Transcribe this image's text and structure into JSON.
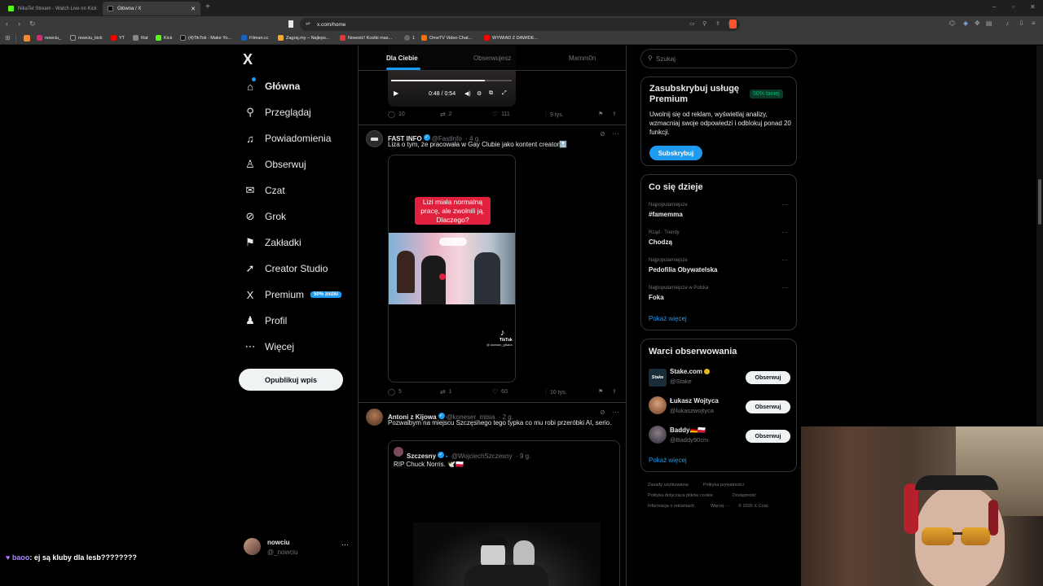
{
  "browser": {
    "tabs": [
      {
        "title": "NikaTel Stream - Watch Live on Kick",
        "active": false
      },
      {
        "title": "Główna / X",
        "active": true
      }
    ],
    "new_tab_symbol": "+",
    "url": "x.com/home",
    "bookmarks": [
      "nowciu_",
      "nowciu_kick",
      "YT",
      "Rat",
      "Kick",
      "(4)TikTok - Make Yo...",
      "Filman.cc",
      "Zagraj.my – Najleps...",
      "Nowość! Kostki mas...",
      "1",
      "OmeTV Video Chat...",
      "WYWIAD Z DAWIDE..."
    ]
  },
  "nav": {
    "logo": "X",
    "items": [
      {
        "label": "Główna",
        "icon": "home-icon",
        "glyph": "⌂"
      },
      {
        "label": "Przeglądaj",
        "icon": "search-icon",
        "glyph": "⚲"
      },
      {
        "label": "Powiadomienia",
        "icon": "bell-icon",
        "glyph": "♫"
      },
      {
        "label": "Obserwuj",
        "icon": "add-user-icon",
        "glyph": "♙"
      },
      {
        "label": "Czat",
        "icon": "mail-icon",
        "glyph": "✉"
      },
      {
        "label": "Grok",
        "icon": "grok-icon",
        "glyph": "⊘"
      },
      {
        "label": "Zakładki",
        "icon": "bookmark-icon",
        "glyph": "⚑"
      },
      {
        "label": "Creator Studio",
        "icon": "rocket-icon",
        "glyph": "➚"
      },
      {
        "label": "Premium",
        "icon": "x-premium-icon",
        "glyph": "X"
      },
      {
        "label": "Profil",
        "icon": "profile-icon",
        "glyph": "♟"
      },
      {
        "label": "Więcej",
        "icon": "more-circle-icon",
        "glyph": "⋯"
      }
    ],
    "premium_badge": "50% zniżki",
    "post_button": "Opublikuj wpis",
    "account": {
      "name": "nowciu",
      "handle": "@_nowciu",
      "menu": "···"
    }
  },
  "timeline": {
    "tabs": [
      "Dla Ciebie",
      "Obserwujesz",
      "Mamm0n"
    ],
    "video_player": {
      "time": "0:48 / 0:54",
      "progress": 0.78
    },
    "tweet0_actions": {
      "replies": "10",
      "reposts": "2",
      "likes": "111",
      "views": "9 tys."
    },
    "tweet1": {
      "name": "FAST INFO",
      "handle": "@FastInfo",
      "time": "· 4 g.",
      "text": "Liza o tym, że pracowała w Gay Clubie jako kontent creator🔝",
      "caption": "Lizi miała normalną pracę, ale zwolnili ją. Dlaczego?",
      "tiktok_label": "TikTok",
      "tiktok_user": "@ damian_gliwka",
      "actions": {
        "replies": "5",
        "reposts": "1",
        "likes": "60",
        "views": "10 tys."
      }
    },
    "tweet2": {
      "name": "Antoni z Kijowa",
      "handle": "@koneser_misia",
      "time": "· 2 g.",
      "text": "Pozwalbym na miejscu Szczęsnego tego typka co mu robi przeróbki AI, serio.",
      "quote": {
        "name": "Szczesny",
        "handle": "@WojciechSzczesny",
        "time": "· 9 g.",
        "text": "RIP Chuck Norris. 🕊️🇵🇱"
      }
    }
  },
  "sidebar": {
    "search_placeholder": "Szukaj",
    "premium": {
      "title": "Zasubskrybuj usługę Premium",
      "badge": "50% taniej",
      "text": "Uwolnij się od reklam, wyświetlaj analizy, wzmacniaj swoje odpowiedzi i odblokuj ponad 20 funkcji.",
      "button": "Subskrybuj"
    },
    "trends": {
      "title": "Co się dzieje",
      "items": [
        {
          "meta": "Najpopularniejsze",
          "name": "#famemma"
        },
        {
          "meta": "Rząd · Trendy",
          "name": "Chodzą"
        },
        {
          "meta": "Najpopularniejsze",
          "name": "Pedofilia Obywatelska"
        },
        {
          "meta": "Najpopularniejsze w Polska",
          "name": "Foka"
        }
      ],
      "show_more": "Pokaż więcej"
    },
    "who_to_follow": {
      "title": "Warci obserwowania",
      "items": [
        {
          "name": "Stake.com",
          "handle": "@Stake",
          "button": "Obserwuj",
          "avatar_text": "Stake"
        },
        {
          "name": "Łukasz Wojtyca",
          "handle": "@lukaszwojtyca",
          "button": "Obserwuj"
        },
        {
          "name": "Baddy🇩🇪🇵🇱",
          "handle": "@Baddy90cm",
          "button": "Obserwuj"
        }
      ],
      "show_more": "Pokaż więcej"
    },
    "footer": [
      "Zasady użytkowania",
      "Polityka prywatności",
      "Polityka dotycząca plików cookie",
      "Dostępność",
      "Informacja o reklamach",
      "Więcej ···",
      "© 2026 X Corp."
    ]
  },
  "chat_overlay": {
    "user": "baoo",
    "message": ": ej są kluby dla lesb????????"
  },
  "colors": {
    "accent": "#1d9bf0",
    "green": "#00ba7c",
    "background": "#000000"
  }
}
